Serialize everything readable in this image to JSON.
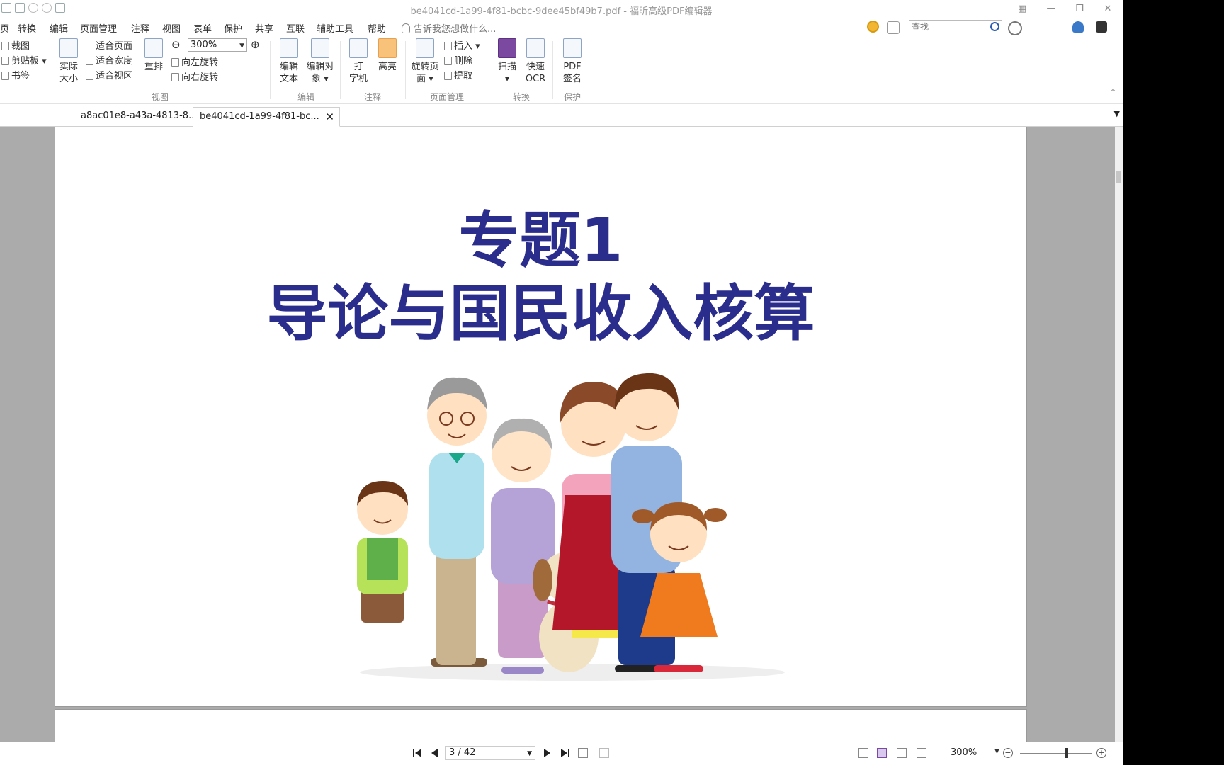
{
  "window": {
    "title": "be4041cd-1a99-4f81-bcbc-9dee45bf49b7.pdf - 福昕高级PDF编辑器"
  },
  "menu": {
    "items": [
      "页",
      "转换",
      "编辑",
      "页面管理",
      "注释",
      "视图",
      "表单",
      "保护",
      "共享",
      "互联",
      "辅助工具",
      "帮助"
    ],
    "tell_me": "告诉我您想做什么..."
  },
  "search": {
    "placeholder": "查找"
  },
  "ribbon": {
    "crop_label": "裁图",
    "clipboard_label": "剪贴板",
    "bookmark_label": "书签",
    "actual_size_label_1": "实际",
    "actual_size_label_2": "大小",
    "fit_page_label": "适合页面",
    "fit_width_label": "适合宽度",
    "fit_visible_label": "适合视区",
    "reflow_label": "重排",
    "zoom_value": "300%",
    "rotate_left_label": "向左旋转",
    "rotate_right_label": "向右旋转",
    "edit_text_label_1": "编辑",
    "edit_text_label_2": "文本",
    "edit_object_label_1": "编辑对",
    "edit_object_label_2": "象",
    "typewriter_label_1": "打",
    "typewriter_label_2": "字机",
    "highlight_label": "高亮",
    "rotate_pages_label_1": "旋转页",
    "rotate_pages_label_2": "面",
    "insert_label": "插入",
    "delete_label": "删除",
    "extract_label": "提取",
    "scan_label": "扫描",
    "quick_ocr_label_1": "快速",
    "quick_ocr_label_2": "OCR",
    "pdf_sign_label_1": "PDF",
    "pdf_sign_label_2": "签名",
    "groups": {
      "view": "视图",
      "edit": "编辑",
      "comment": "注释",
      "page_management": "页面管理",
      "convert": "转换",
      "protect": "保护"
    }
  },
  "tabs": [
    {
      "label": "a8ac01e8-a43a-4813-8..."
    },
    {
      "label": "be4041cd-1a99-4f81-bc..."
    }
  ],
  "document": {
    "title_line_1": "专题1",
    "title_line_2": "导论与国民收入核算"
  },
  "status": {
    "page_indicator": "3 / 42",
    "zoom": "300%"
  },
  "colors": {
    "title_text": "#2b2d8c",
    "highlight_button": "#f8c27a",
    "coin": "#f2b632"
  },
  "icons": [
    "undo-icon",
    "redo-icon",
    "hand-icon",
    "zoom-out-icon",
    "zoom-in-icon",
    "bulb-icon",
    "search-icon",
    "gear-icon",
    "bell-icon",
    "user-icon",
    "close-icon",
    "first-page-icon",
    "prev-page-icon",
    "next-page-icon",
    "last-page-icon"
  ]
}
